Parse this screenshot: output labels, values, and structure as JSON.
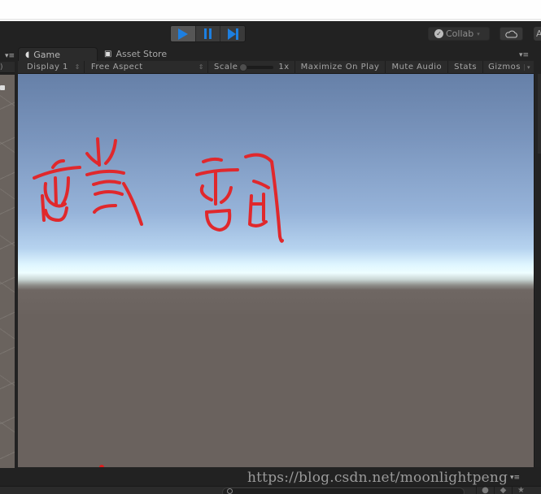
{
  "toolbar": {
    "play_icon": "play-icon",
    "pause_icon": "pause-icon",
    "step_icon": "step-icon",
    "play_active": true,
    "collab_label": "Collab",
    "collab_icon": "check-circle-icon",
    "cloud_icon": "cloud-icon",
    "account_label": "A"
  },
  "tabs": [
    {
      "label": "Game",
      "icon": "pacman-icon",
      "active": true
    },
    {
      "label": "Asset Store",
      "icon": "bag-icon",
      "active": false
    }
  ],
  "game_bar": {
    "display": "Display 1",
    "aspect": "Free Aspect",
    "scale_label": "Scale",
    "scale_value": "1x",
    "scale_fraction": 0.0,
    "maximize_on_play": "Maximize On Play",
    "mute_audio": "Mute Audio",
    "stats": "Stats",
    "gizmos": "Gizmos"
  },
  "scene": {
    "sky_top_color": "#6680a8",
    "horizon_color": "#eefeff",
    "ground_color": "#6a625e",
    "drawing_color": "#e0282c"
  },
  "watermark": "https://blog.csdn.net/moonlightpeng",
  "glyphs": {
    "spinner": "⇕",
    "menu": "▾≡",
    "dropdown": "▾"
  }
}
